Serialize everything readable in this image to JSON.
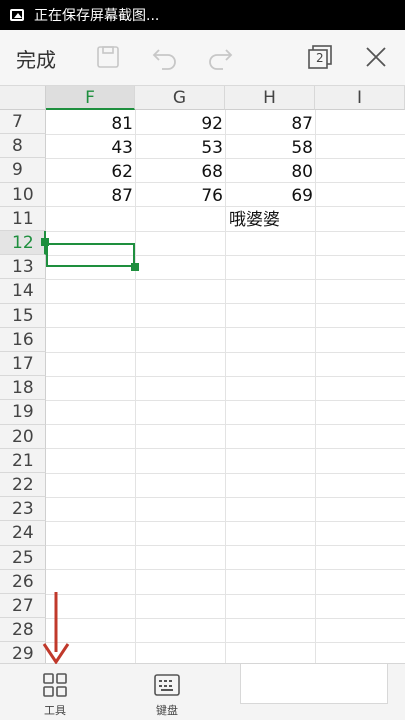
{
  "status_bar": {
    "text": "正在保存屏幕截图..."
  },
  "toolbar": {
    "done_label": "完成",
    "sheet_count": "2",
    "icons": [
      "save-icon",
      "undo-icon",
      "redo-icon",
      "sheets-icon",
      "close-icon"
    ]
  },
  "grid": {
    "columns": [
      "F",
      "G",
      "H",
      "I"
    ],
    "selected_column": "F",
    "rows": [
      "7",
      "8",
      "9",
      "10",
      "11",
      "12",
      "13",
      "14",
      "15",
      "16",
      "17",
      "18",
      "19",
      "20",
      "21",
      "22",
      "23",
      "24",
      "25",
      "26",
      "27",
      "28",
      "29"
    ],
    "selected_row": "12",
    "cells": {
      "r7": {
        "F": "81",
        "G": "92",
        "H": "87"
      },
      "r8": {
        "F": "43",
        "G": "53",
        "H": "58"
      },
      "r9": {
        "F": "62",
        "G": "68",
        "H": "80"
      },
      "r10": {
        "F": "87",
        "G": "76",
        "H": "69"
      },
      "r11": {
        "H": "哦婆婆"
      }
    }
  },
  "bottom_bar": {
    "tools_label": "工具",
    "keyboard_label": "键盘"
  },
  "colors": {
    "accent": "#1e8f3e",
    "arrow": "#c0392b"
  }
}
